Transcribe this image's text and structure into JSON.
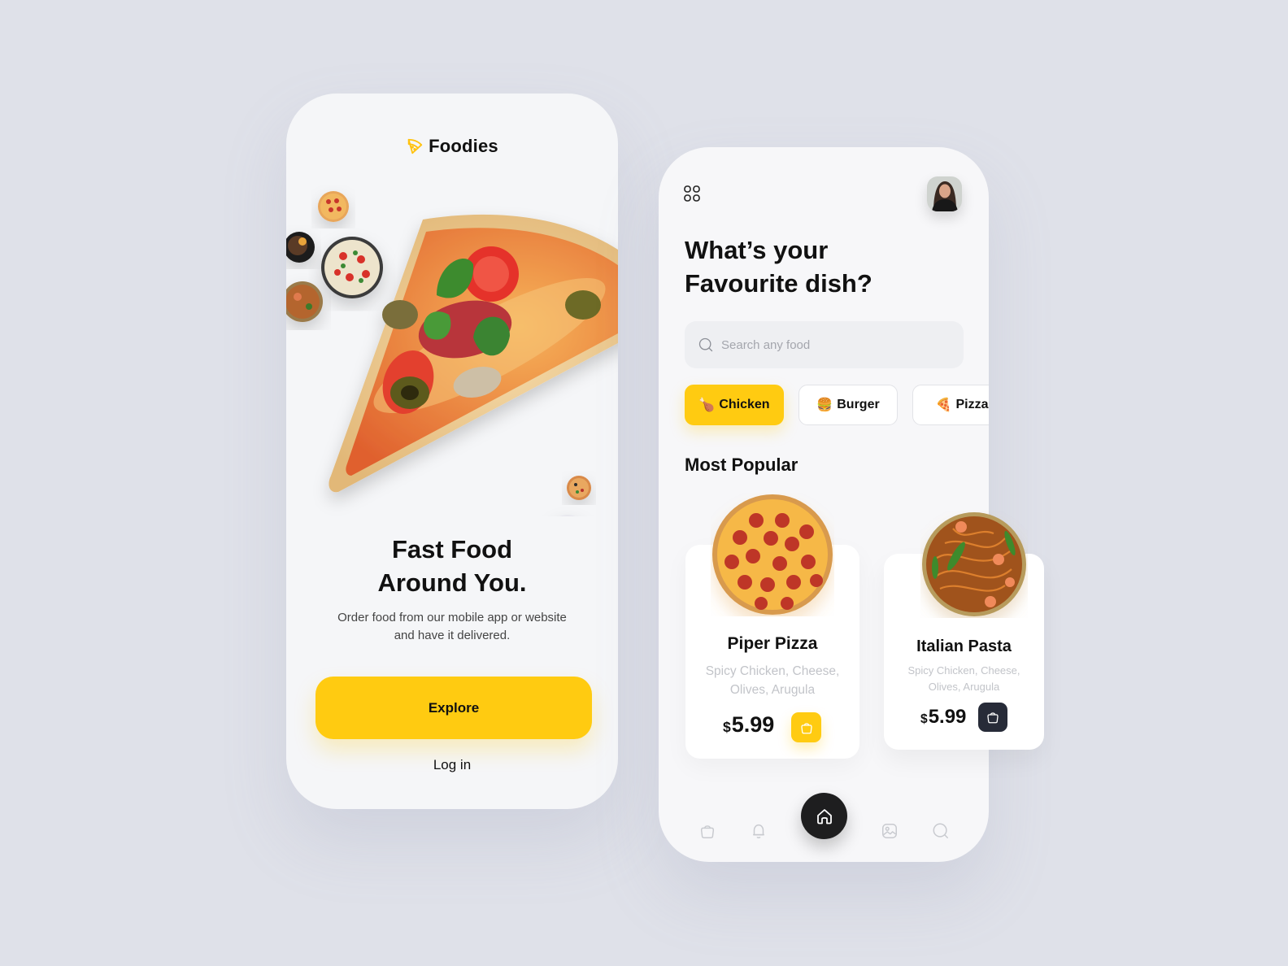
{
  "colors": {
    "background": "#DFE1E9",
    "accent": "#FFCB11",
    "dark": "#1E1E1F",
    "dark_button": "#272B38",
    "muted_text": "#C2C4C9"
  },
  "welcome_screen": {
    "brand": {
      "icon": "pizza-slice-outline-icon",
      "name": "Foodies"
    },
    "headline_line1": "Fast Food",
    "headline_line2": "Around You.",
    "subtitle_line1": "Order food from our mobile app or website",
    "subtitle_line2": "and have it delivered.",
    "explore_label": "Explore",
    "login_label": "Log in"
  },
  "home_screen": {
    "menu_icon": "grid-icon",
    "avatar_alt": "User profile photo",
    "question_line1": "What’s your",
    "question_line2": "Favourite dish?",
    "search": {
      "placeholder": "Search any food",
      "value": ""
    },
    "categories": [
      {
        "emoji": "🍗",
        "label": "Chicken",
        "active": true
      },
      {
        "emoji": "🍔",
        "label": "Burger",
        "active": false
      },
      {
        "emoji": "🍕",
        "label": "Pizza",
        "active": false
      }
    ],
    "section_title": "Most Popular",
    "popular": [
      {
        "name": "Piper Pizza",
        "desc_line1": "Spicy Chicken, Cheese,",
        "desc_line2": "Olives, Arugula",
        "currency": "$",
        "price": "5.99",
        "image": "pepperoni-pizza"
      },
      {
        "name": "Italian Pasta",
        "desc_line1": "Spicy Chicken, Cheese,",
        "desc_line2": "Olives, Arugula",
        "currency": "$",
        "price": "5.99",
        "image": "shrimp-noodle-bowl"
      }
    ],
    "bottom_nav": [
      {
        "icon": "shopping-bag-icon",
        "active": false
      },
      {
        "icon": "bell-icon",
        "active": false
      },
      {
        "icon": "home-icon",
        "active": true
      },
      {
        "icon": "image-icon",
        "active": false
      },
      {
        "icon": "search-icon",
        "active": false
      }
    ]
  }
}
